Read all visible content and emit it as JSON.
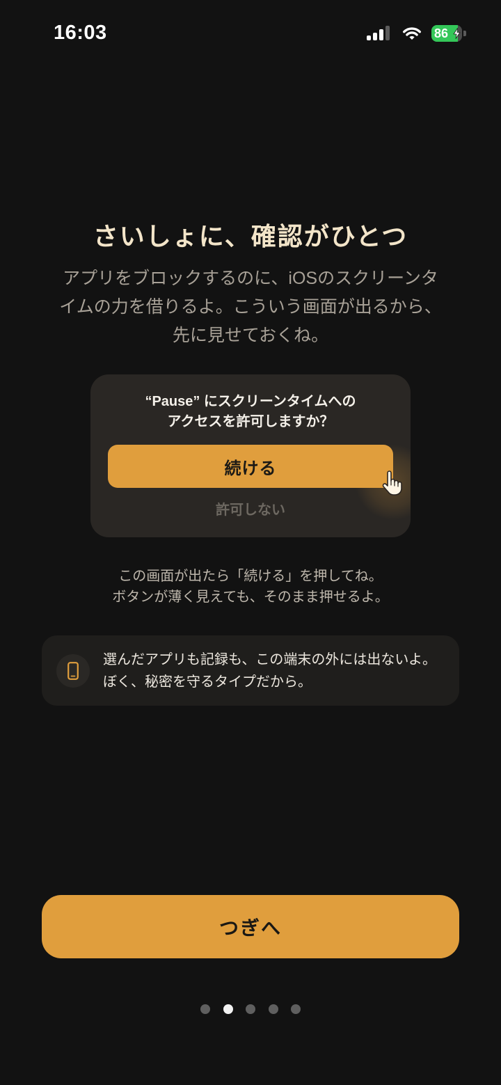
{
  "status_bar": {
    "time": "16:03",
    "battery_level": "86",
    "signal_bars": 3,
    "signal_bars_max": 4,
    "icons": [
      "cellular-signal-icon",
      "wifi-icon",
      "battery-icon",
      "charging-bolt-icon"
    ]
  },
  "header": {
    "title": "さいしょに、確認がひとつ",
    "description_lines": [
      "アプリをブロックするのに、iOSのスクリーンタ",
      "イムの力を借りるよ。こういう画面が出るから、",
      "先に見せておくね。"
    ]
  },
  "permission_preview": {
    "message_lines": [
      "“Pause” にスクリーンタイムへの",
      "アクセスを許可しますか？"
    ],
    "continue_label": "続ける",
    "deny_label": "許可しない",
    "pointer_icon": "hand-pointer-icon"
  },
  "hint": {
    "lines": [
      "この画面が出たら「続ける」を押してね。",
      "ボタンが薄く見えても、そのまま押せるよ。"
    ]
  },
  "privacy_note": {
    "icon": "smartphone-icon",
    "lines": [
      "選んだアプリも記録も、この端末の外には出ないよ。",
      "ぼく、秘密を守るタイプだから。"
    ]
  },
  "next_button": {
    "label": "つぎへ"
  },
  "pagination": {
    "total": 5,
    "current": 2
  },
  "colors": {
    "background": "#121212",
    "accent": "#E09E3D",
    "title": "#F3E5C9",
    "battery": "#34C759"
  }
}
